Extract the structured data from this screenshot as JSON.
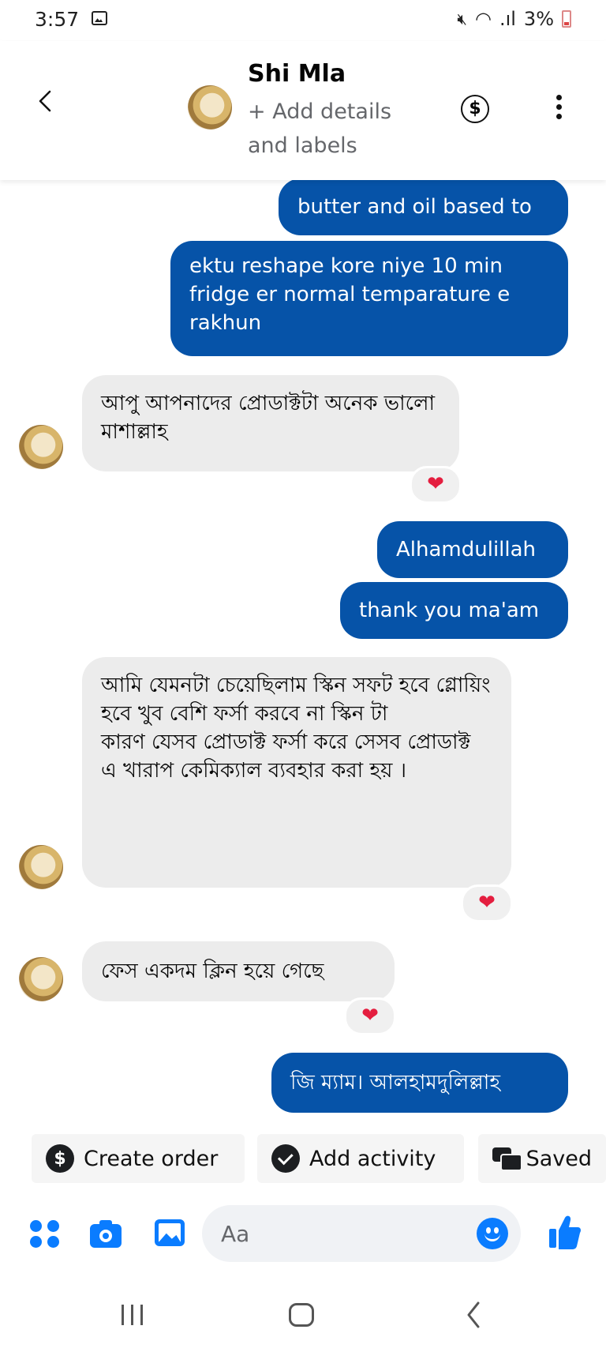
{
  "status_bar": {
    "time": "3:57",
    "battery": "3%"
  },
  "header": {
    "contact_name": "Shi Mla",
    "add_details": "+ Add details and labels",
    "back_icon": "chevron-left-icon",
    "payment_icon": "dollar-circle-icon",
    "more_icon": "more-vertical-icon"
  },
  "messages": [
    {
      "direction": "out",
      "text": "butter and oil based to"
    },
    {
      "direction": "out",
      "text": "ektu reshape kore niye 10 min fridge er normal temparature e rakhun"
    },
    {
      "direction": "in",
      "text": "আপু আপনাদের প্রোডাক্টটা অনেক ভালো মাশাল্লাহ",
      "reaction": "❤"
    },
    {
      "direction": "out",
      "text": "Alhamdulillah"
    },
    {
      "direction": "out",
      "text": "thank you ma'am"
    },
    {
      "direction": "in",
      "text": "আমি যেমনটা চেয়েছিলাম  স্কিন সফট হবে গ্লোয়িং হবে খুব বেশি ফর্সা করবে না স্কিন টা\n কারণ যেসব প্রোডাক্ট ফর্সা করে সেসব প্রোডাক্ট এ খারাপ কেমিক্যাল ব্যবহার করা হয় ।",
      "reaction": "❤"
    },
    {
      "direction": "in",
      "text": "ফেস একদম ক্লিন হয়ে গেছে",
      "reaction": "❤"
    },
    {
      "direction": "out",
      "text": "জি ম্যাম। আলহামদুলিল্লাহ"
    }
  ],
  "quick_actions": [
    {
      "label": "Create order",
      "icon": "dollar-circle-icon"
    },
    {
      "label": "Add activity",
      "icon": "check-circle-icon"
    },
    {
      "label": "Saved",
      "icon": "saved-replies-icon"
    }
  ],
  "composer": {
    "placeholder": "Aa",
    "icons": [
      "apps-icon",
      "camera-icon",
      "gallery-icon",
      "emoji-icon",
      "like-icon"
    ]
  },
  "colors": {
    "outgoing_bubble": "#0653a8",
    "incoming_bubble": "#ececec",
    "accent": "#0a7cff",
    "reaction_heart": "#e41e3f"
  }
}
